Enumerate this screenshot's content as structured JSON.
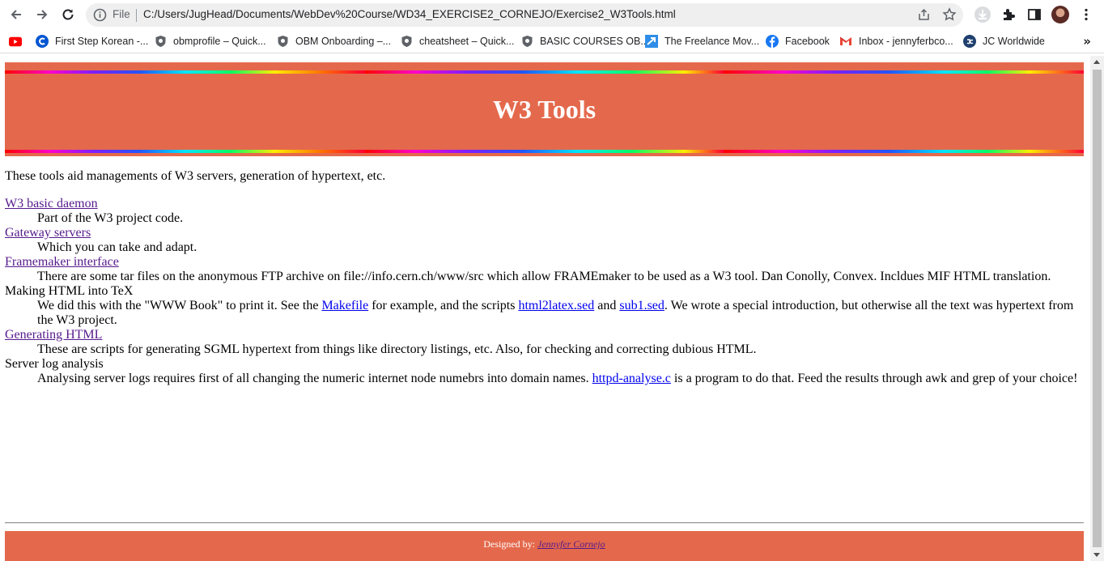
{
  "browser": {
    "omnibox": {
      "scheme_label": "File",
      "url": "C:/Users/JugHead/Documents/WebDev%20Course/WD34_EXERCISE2_CORNEJO/Exercise2_W3Tools.html"
    },
    "bookmarks": [
      {
        "label": "",
        "icon": "youtube-icon"
      },
      {
        "label": "First Step Korean -...",
        "icon": "coursera-icon"
      },
      {
        "label": "obmprofile – Quick...",
        "icon": "shield-icon"
      },
      {
        "label": "OBM Onboarding –...",
        "icon": "shield-icon"
      },
      {
        "label": "cheatsheet – Quick...",
        "icon": "shield-icon"
      },
      {
        "label": "BASIC COURSES OB...",
        "icon": "shield-icon"
      },
      {
        "label": "The Freelance Mov...",
        "icon": "freelance-icon"
      },
      {
        "label": "Facebook",
        "icon": "facebook-icon"
      },
      {
        "label": "Inbox - jennyferbco...",
        "icon": "gmail-icon"
      },
      {
        "label": "JC Worldwide",
        "icon": "jc-icon"
      }
    ],
    "bookmarks_overflow": "»"
  },
  "page": {
    "title": "W3 Tools",
    "intro": "These tools aid managements of W3 servers, generation of hypertext, etc.",
    "tools": [
      {
        "term": "W3 basic daemon",
        "term_link": true,
        "desc_parts": [
          {
            "text": "Part of the W3 project code."
          }
        ]
      },
      {
        "term": "Gateway servers",
        "term_link": true,
        "desc_parts": [
          {
            "text": "Which you can take and adapt."
          }
        ]
      },
      {
        "term": "Framemaker interface",
        "term_link": true,
        "desc_parts": [
          {
            "text": "There are some tar files on the anonymous FTP archive on file://info.cern.ch/www/src which allow FRAMEmaker to be used as a W3 tool. Dan Conolly, Convex. Incldues MIF HTML translation."
          }
        ]
      },
      {
        "term": "Making HTML into TeX",
        "term_link": false,
        "desc_parts": [
          {
            "text": "We did this with the \"WWW Book\" to print it. See the "
          },
          {
            "text": "Makefile",
            "link": true
          },
          {
            "text": " for example, and the scripts "
          },
          {
            "text": "html2latex.sed",
            "link": true
          },
          {
            "text": " and "
          },
          {
            "text": "sub1.sed",
            "link": true
          },
          {
            "text": ". We wrote a special introduction, but otherwise all the text was hypertext from the W3 project."
          }
        ]
      },
      {
        "term": "Generating HTML",
        "term_link": true,
        "desc_parts": [
          {
            "text": "These are scripts for generating SGML hypertext from things like directory listings, etc. Also, for checking and correcting dubious HTML."
          }
        ]
      },
      {
        "term": "Server log analysis",
        "term_link": false,
        "desc_parts": [
          {
            "text": "Analysing server logs requires first of all changing the numeric internet node numebrs into domain names. "
          },
          {
            "text": "httpd-analyse.c",
            "link": true
          },
          {
            "text": " is a program to do that. Feed the results through awk and grep of your choice!"
          }
        ]
      }
    ],
    "footer": {
      "prefix": "Designed by: ",
      "author": "Jennyfer Cornejo"
    }
  }
}
